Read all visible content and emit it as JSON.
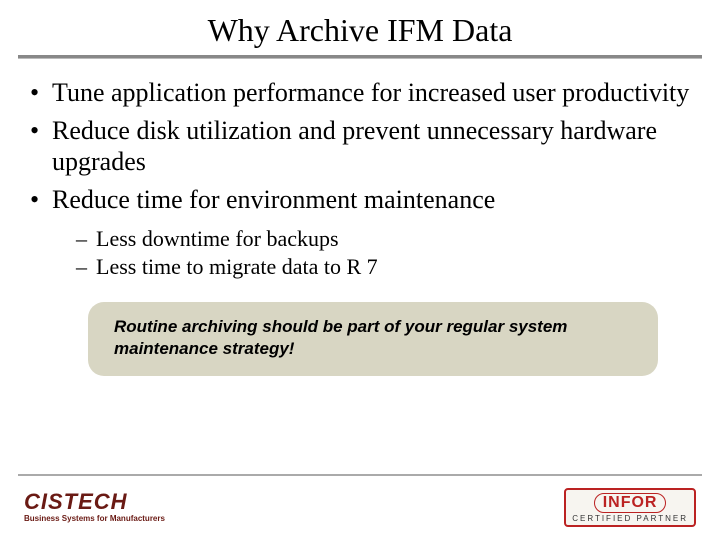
{
  "title": "Why Archive IFM Data",
  "bullets": [
    "Tune application performance for increased user productivity",
    "Reduce disk utilization and prevent unnecessary hardware upgrades",
    "Reduce time for environment maintenance"
  ],
  "sub_bullets": [
    "Less downtime for backups",
    "Less time to migrate data to R 7"
  ],
  "callout": "Routine archiving should be part of your regular system maintenance strategy!",
  "footer": {
    "left_brand": "CISTECH",
    "left_tagline": "Business Systems for Manufacturers",
    "right_brand": "INFOR",
    "right_sub": "CERTIFIED PARTNER"
  }
}
